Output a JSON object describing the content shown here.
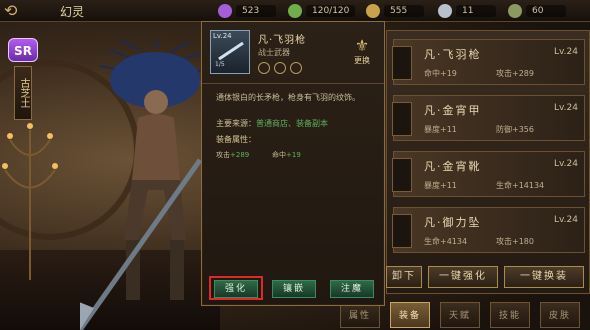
{
  "topbar": {
    "back_icon": "back-arrow-icon",
    "title": "幻灵",
    "resources": [
      {
        "icon": "purple-gem-icon",
        "value": "523",
        "color": "#a45fd8"
      },
      {
        "icon": "green-stamina-icon",
        "value": "120/120",
        "color": "#6fae4a"
      },
      {
        "icon": "coin-icon",
        "value": "555",
        "color": "#c9a24a"
      },
      {
        "icon": "silver-icon",
        "value": "11",
        "color": "#b8c2cc"
      },
      {
        "icon": "ore-icon",
        "value": "60",
        "color": "#8a9a62"
      }
    ]
  },
  "hero": {
    "rarity": "SR",
    "name_tag": "古芝土"
  },
  "popup": {
    "level": "Lv.24",
    "level_bottom": "1/5",
    "name": "凡·飞羽枪",
    "type": "战士武器",
    "swap_label": "更换",
    "description": "通体银白的长矛枪，枪身有飞羽的纹饰。",
    "source_label": "主要来源：",
    "source_value": "普通商店、装备副本",
    "attr_header": "装备属性：",
    "attrs": [
      {
        "label": "攻击",
        "value": "+289"
      },
      {
        "label": "命中",
        "value": "+19"
      }
    ],
    "buttons": [
      "强化",
      "镶嵌",
      "注魔"
    ]
  },
  "equipment_list": [
    {
      "name": "凡·飞羽枪",
      "level": "Lv.24",
      "stat1": "命中+19",
      "stat2": "攻击+289"
    },
    {
      "name": "凡·金宵甲",
      "level": "Lv.24",
      "stat1": "暴度+11",
      "stat2": "防御+356"
    },
    {
      "name": "凡·金宵靴",
      "level": "Lv.24",
      "stat1": "暴度+11",
      "stat2": "生命+14134"
    },
    {
      "name": "凡·御力坠",
      "level": "Lv.24",
      "stat1": "生命+4134",
      "stat2": "攻击+180"
    }
  ],
  "bottom_buttons": [
    "卸下",
    "一键强化",
    "一键换装"
  ],
  "tabs": [
    {
      "label": "属性",
      "active": false
    },
    {
      "label": "装备",
      "active": true
    },
    {
      "label": "天赋",
      "active": false
    },
    {
      "label": "技能",
      "active": false
    },
    {
      "label": "皮肤",
      "active": false
    }
  ],
  "highlight_color": "#e12828"
}
